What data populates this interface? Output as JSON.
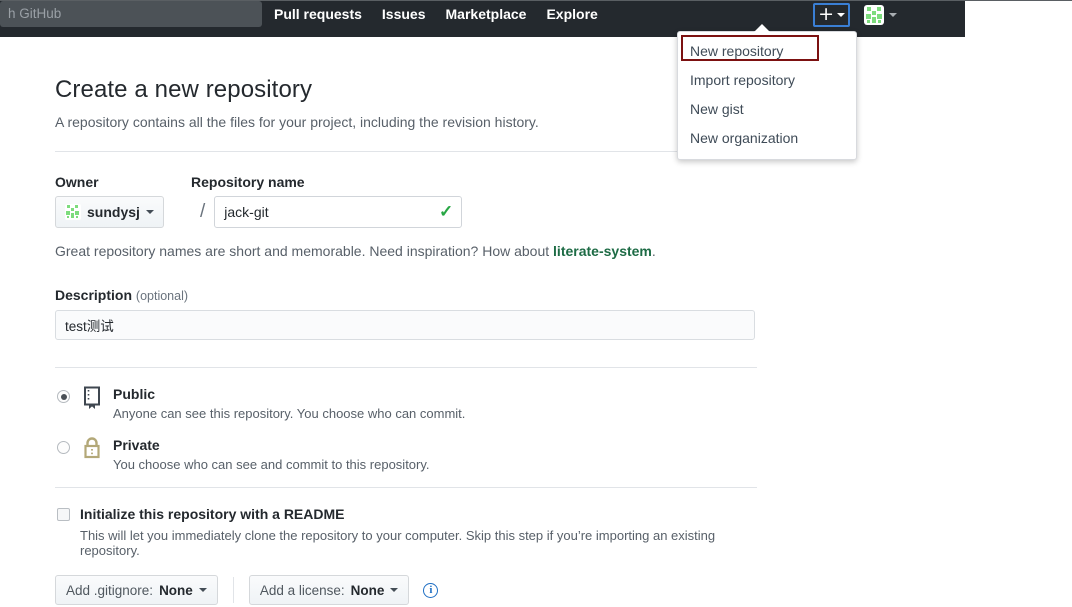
{
  "header": {
    "search_value": "h GitHub",
    "search_placeholder": "Search GitHub",
    "nav": [
      {
        "label": "Pull requests"
      },
      {
        "label": "Issues"
      },
      {
        "label": "Marketplace"
      },
      {
        "label": "Explore"
      }
    ],
    "plus_glyph": "+",
    "create_icon_name": "plus-icon",
    "avatar_icon_name": "user-identicon-avatar"
  },
  "dropdown": {
    "items": [
      {
        "label": "New repository",
        "highlighted": true
      },
      {
        "label": "Import repository",
        "highlighted": false
      },
      {
        "label": "New gist",
        "highlighted": false
      },
      {
        "label": "New organization",
        "highlighted": false
      }
    ],
    "highlight_color": "#7c1111"
  },
  "page": {
    "title": "Create a new repository",
    "subtitle": "A repository contains all the files for your project, including the revision history."
  },
  "owner": {
    "label": "Owner",
    "name": "sundysj"
  },
  "repository": {
    "label": "Repository name",
    "value": "jack-git",
    "placeholder": "",
    "valid_icon": "✓",
    "hint_prefix": "Great repository names are short and memorable. Need inspiration? How about ",
    "hint_suggestion": "literate-system",
    "hint_suffix": "."
  },
  "description": {
    "label": "Description",
    "optional_text": "(optional)",
    "value": "test测试",
    "placeholder": ""
  },
  "visibility": {
    "options": [
      {
        "title": "Public",
        "description": "Anyone can see this repository. You choose who can commit.",
        "selected": true,
        "icon": "repo-book-icon"
      },
      {
        "title": "Private",
        "description": "You choose who can see and commit to this repository.",
        "selected": false,
        "icon": "lock-icon"
      }
    ]
  },
  "readme": {
    "label": "Initialize this repository with a README",
    "description": "This will let you immediately clone the repository to your computer. Skip this step if you’re importing an existing repository.",
    "checked": false
  },
  "extras": {
    "gitignore_prefix": "Add .gitignore: ",
    "gitignore_value": "None",
    "license_prefix": "Add a license: ",
    "license_value": "None",
    "info_glyph": "i"
  },
  "colors": {
    "header_bg": "#24292e",
    "accent_green": "#28a745",
    "link_green": "#1d6b45",
    "focus_blue": "#3a7fd5",
    "info_blue": "#1f6fc4"
  }
}
